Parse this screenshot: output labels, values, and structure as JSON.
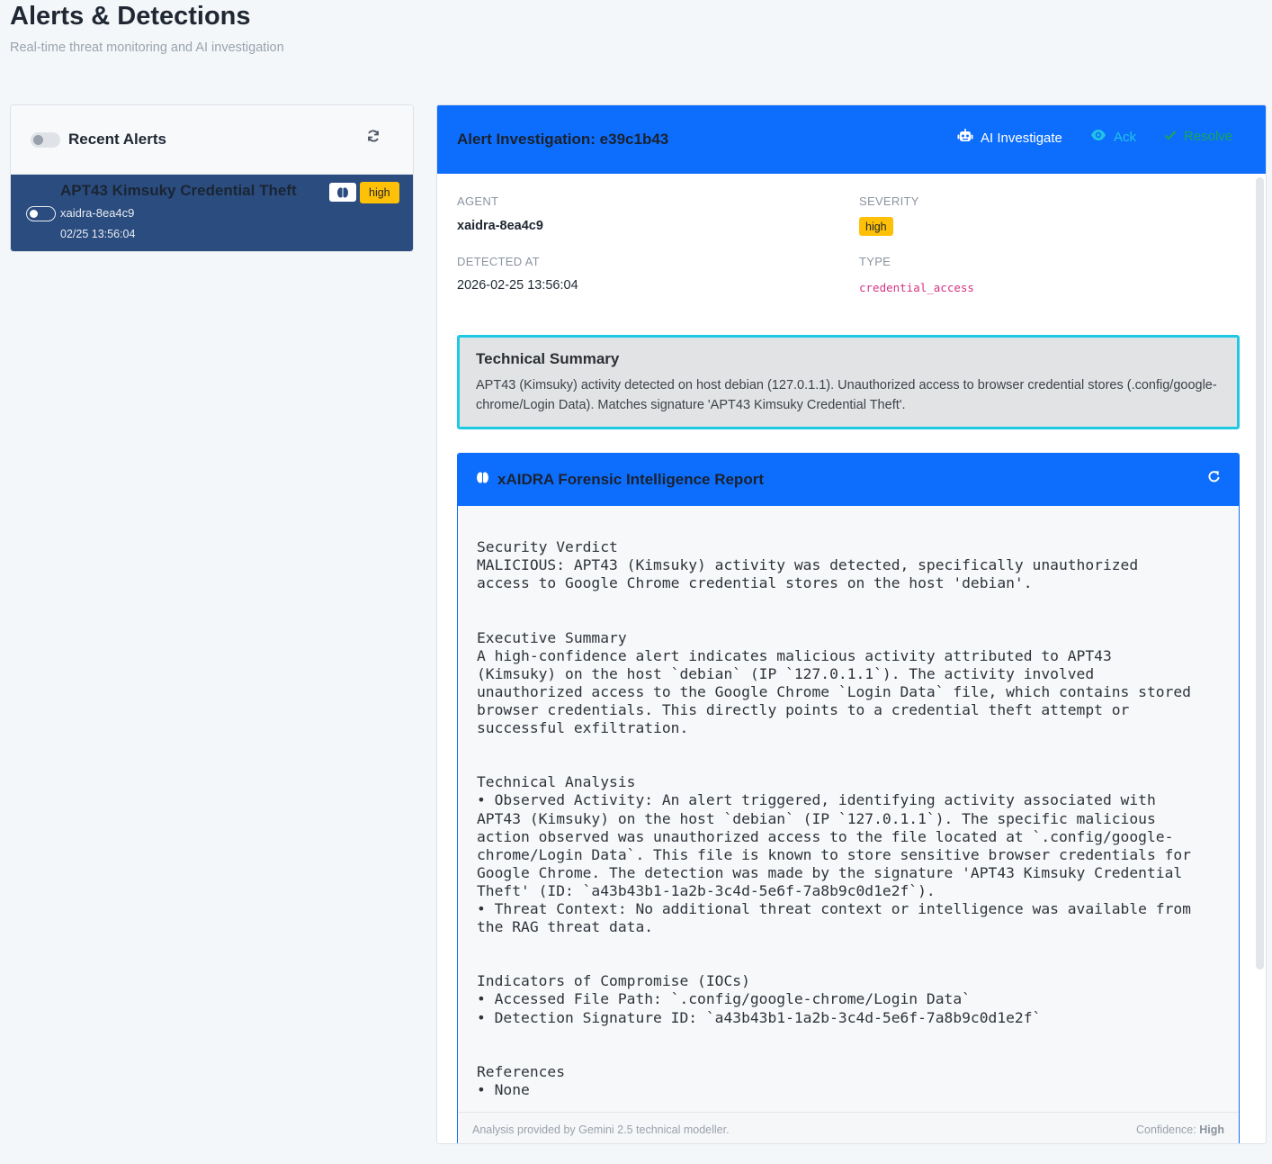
{
  "page": {
    "title": "Alerts & Detections",
    "subtitle": "Real-time threat monitoring and AI investigation"
  },
  "sidebar": {
    "title": "Recent Alerts",
    "refresh_icon": "refresh-icon",
    "alerts": [
      {
        "title": "APT43 Kimsuky Credential Theft",
        "agent": "xaidra-8ea4c9",
        "time": "02/25 13:56:04",
        "severity": "high",
        "ai_icon": "brain-icon"
      }
    ]
  },
  "investigation": {
    "title": "Alert Investigation: e39c1b43",
    "actions": {
      "ai_label": "AI Investigate",
      "ack_label": "Ack",
      "resolve_label": "Resolve"
    },
    "fields": {
      "agent_label": "AGENT",
      "agent_value": "xaidra-8ea4c9",
      "severity_label": "SEVERITY",
      "severity_value": "high",
      "detected_label": "DETECTED AT",
      "detected_value": "2026-02-25 13:56:04",
      "type_label": "TYPE",
      "type_value": "credential_access"
    },
    "technical_summary": {
      "title": "Technical Summary",
      "text": "APT43 (Kimsuky) activity detected on host debian (127.0.1.1). Unauthorized access to browser credential stores (.config/google-chrome/Login Data). Matches signature 'APT43 Kimsuky Credential Theft'."
    },
    "report": {
      "title": "xAIDRA Forensic Intelligence Report",
      "body": "\nSecurity Verdict\nMALICIOUS: APT43 (Kimsuky) activity was detected, specifically unauthorized\naccess to Google Chrome credential stores on the host 'debian'.\n\n\nExecutive Summary\nA high-confidence alert indicates malicious activity attributed to APT43\n(Kimsuky) on the host `debian` (IP `127.0.1.1`). The activity involved\nunauthorized access to the Google Chrome `Login Data` file, which contains stored\nbrowser credentials. This directly points to a credential theft attempt or\nsuccessful exfiltration.\n\n\nTechnical Analysis\n• Observed Activity: An alert triggered, identifying activity associated with\nAPT43 (Kimsuky) on the host `debian` (IP `127.0.1.1`). The specific malicious\naction observed was unauthorized access to the file located at `.config/google-\nchrome/Login Data`. This file is known to store sensitive browser credentials for\nGoogle Chrome. The detection was made by the signature 'APT43 Kimsuky Credential\nTheft' (ID: `a43b43b1-1a2b-3c4d-5e6f-7a8b9c0d1e2f`).\n• Threat Context: No additional threat context or intelligence was available from\nthe RAG threat data.\n\n\nIndicators of Compromise (IOCs)\n• Accessed File Path: `.config/google-chrome/Login Data`\n• Detection Signature ID: `a43b43b1-1a2b-3c4d-5e6f-7a8b9c0d1e2f`\n\n\nReferences\n• None",
      "footer_text": "Analysis provided by Gemini 2.5 technical modeller.",
      "confidence_label": "Confidence:",
      "confidence_value": "High"
    }
  },
  "colors": {
    "primary": "#0d6efd",
    "warning": "#ffc107",
    "info": "#1fc8e3",
    "success": "#18a65a",
    "selected_row": "#2b4c7e"
  }
}
